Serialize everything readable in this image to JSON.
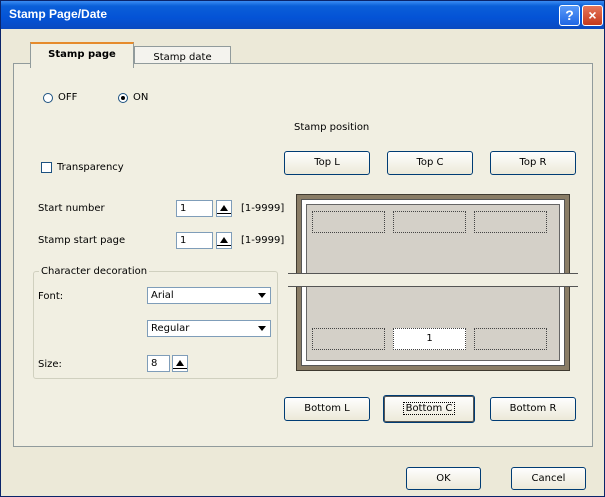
{
  "window": {
    "title": "Stamp Page/Date"
  },
  "titlebar": {
    "help_icon": "?",
    "close_icon": "×"
  },
  "tabs": [
    {
      "label": "Stamp page",
      "active": true
    },
    {
      "label": "Stamp date",
      "active": false
    }
  ],
  "mode": {
    "off_label": "OFF",
    "on_label": "ON",
    "selected": "ON"
  },
  "transparency": {
    "label": "Transparency",
    "checked": false
  },
  "start_number": {
    "label": "Start number",
    "value": "1",
    "range": "[1-9999]"
  },
  "stamp_start_page": {
    "label": "Stamp start page",
    "value": "1",
    "range": "[1-9999]"
  },
  "character_decoration": {
    "title": "Character decoration",
    "font_label": "Font:",
    "font_value": "Arial",
    "style_value": "Regular",
    "size_label": "Size:",
    "size_value": "8"
  },
  "stamp_position": {
    "label": "Stamp position",
    "top_left": "Top L",
    "top_center": "Top C",
    "top_right": "Top R",
    "bottom_left": "Bottom L",
    "bottom_center": "Bottom C",
    "bottom_right": "Bottom R",
    "selected": "Bottom C",
    "preview_number": "1"
  },
  "footer": {
    "ok_label": "OK",
    "cancel_label": "Cancel"
  }
}
